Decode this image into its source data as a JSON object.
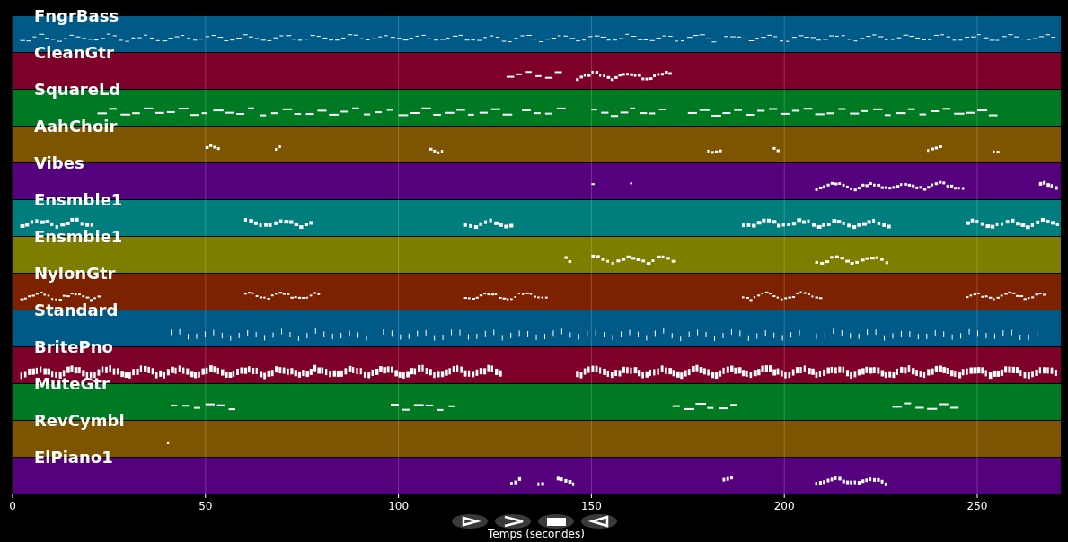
{
  "tracks": [
    {
      "name": "FngrBass",
      "color": "#005a87"
    },
    {
      "name": "CleanGtr",
      "color": "#7d0028"
    },
    {
      "name": "SquareLd",
      "color": "#007a22"
    },
    {
      "name": "AahChoir",
      "color": "#7d5400"
    },
    {
      "name": "Vibes",
      "color": "#55007d"
    },
    {
      "name": "Ensmble1",
      "color": "#007d7d"
    },
    {
      "name": "Ensmble1",
      "color": "#7d7d00"
    },
    {
      "name": "NylonGtr",
      "color": "#7d2200"
    },
    {
      "name": "Standard",
      "color": "#005a87"
    },
    {
      "name": "BritePno",
      "color": "#7d0028"
    },
    {
      "name": "MuteGtr",
      "color": "#007a22"
    },
    {
      "name": "RevCymbl",
      "color": "#7d5400"
    },
    {
      "name": "ElPiano1",
      "color": "#55007d"
    }
  ],
  "x_axis": {
    "ticks": [
      "0",
      "50",
      "100",
      "150",
      "200",
      "250"
    ],
    "label": "Temps (secondes)"
  }
}
